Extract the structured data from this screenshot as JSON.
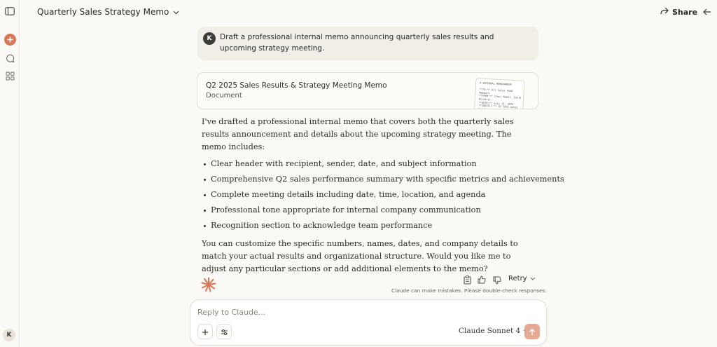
{
  "header": {
    "title": "Quarterly Sales Strategy Memo",
    "share_label": "Share"
  },
  "sidebar": {
    "user_initial": "K",
    "icons": [
      "sidebar-toggle-icon",
      "new-chat-icon",
      "chats-icon",
      "projects-icon"
    ]
  },
  "user_message": {
    "initial": "K",
    "text": "Draft a professional internal memo announcing quarterly sales results and upcoming strategy meeting."
  },
  "artifact": {
    "title": "Q2 2025 Sales Results & Strategy Meeting Memo",
    "type": "Document",
    "preview": "# INTERNAL MEMORANDUM\n\n**TO:** All Sales Team\nMembers\n**FROM:** [Your Name], Sales\nDirector\n**DATE:** July 15, 2025\n**SUBJECT:** Q2 2025 Sales\nResults and Upcoming Strategy\nMeeting"
  },
  "response": {
    "intro": "I've drafted a professional internal memo that covers both the quarterly sales results announcement and details about the upcoming strategy meeting. The memo includes:",
    "bullets": [
      "Clear header with recipient, sender, date, and subject information",
      "Comprehensive Q2 sales performance summary with specific metrics and achievements",
      "Complete meeting details including date, time, location, and agenda",
      "Professional tone appropriate for internal company communication",
      "Recognition section to acknowledge team performance"
    ],
    "outro": "You can customize the specific numbers, names, dates, and company details to match your actual results and organizational structure. Would you like me to adjust any particular sections or add additional elements to the memo?"
  },
  "message_actions": {
    "retry_label": "Retry",
    "disclaimer": "Claude can make mistakes. Please double-check responses."
  },
  "composer": {
    "placeholder": "Reply to Claude...",
    "value": "",
    "model": "Claude Sonnet 4"
  },
  "colors": {
    "background": "#faf9f5",
    "accent": "#d97757",
    "send_button": "#e8a994",
    "user_bubble": "#f0eee6"
  }
}
